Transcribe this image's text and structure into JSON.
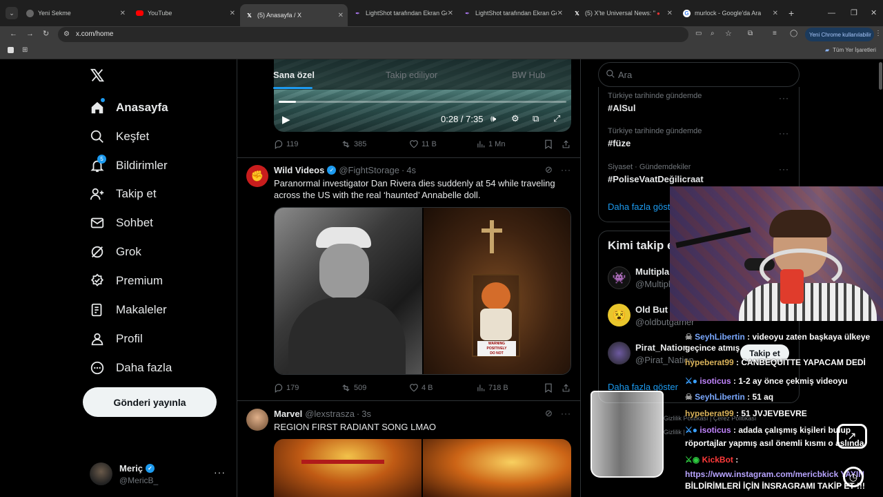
{
  "browser": {
    "tabs": [
      {
        "title": "Yeni Sekme",
        "icon": "chrome-icon"
      },
      {
        "title": "YouTube",
        "icon": "youtube-icon"
      },
      {
        "title": "(5) Anasayfa / X",
        "icon": "x-icon",
        "active": true
      },
      {
        "title": "LightShot tarafından Ekran Gör",
        "icon": "lightshot-icon"
      },
      {
        "title": "LightShot tarafından Ekran Gör",
        "icon": "lightshot-icon"
      },
      {
        "title": "(5) X'te Universal News: \"",
        "icon": "x-icon"
      },
      {
        "title": "murlock - Google'da Ara",
        "icon": "google-icon"
      }
    ],
    "url": "x.com/home",
    "chrome_update": "Yeni Chrome kullanılabilir",
    "bookmarks_label": "Tüm Yer İşaretleri"
  },
  "nav": {
    "items": [
      {
        "label": "Anasayfa",
        "icon": "home-icon"
      },
      {
        "label": "Keşfet",
        "icon": "search-icon"
      },
      {
        "label": "Bildirimler",
        "icon": "bell-icon",
        "badge": "5"
      },
      {
        "label": "Takip et",
        "icon": "person-add-icon"
      },
      {
        "label": "Sohbet",
        "icon": "mail-icon"
      },
      {
        "label": "Grok",
        "icon": "grok-icon"
      },
      {
        "label": "Premium",
        "icon": "premium-icon"
      },
      {
        "label": "Makaleler",
        "icon": "article-icon"
      },
      {
        "label": "Profil",
        "icon": "profile-icon"
      },
      {
        "label": "Daha fazla",
        "icon": "more-circle-icon"
      }
    ],
    "post_button": "Gönderi yayınla",
    "account": {
      "name": "Meriç",
      "handle": "@MericB_"
    }
  },
  "feed": {
    "tabs": [
      "Sana özel",
      "Takip ediliyor",
      "BW Hub"
    ],
    "video": {
      "time": "0:28 / 7:35",
      "progress": 0.06
    },
    "post1_stats": {
      "replies": "119",
      "reposts": "385",
      "likes": "11 B",
      "views": "1 Mn"
    },
    "post2": {
      "author": "Wild Videos",
      "handle": "@FightStorage",
      "time": "4s",
      "text": "Paranormal investigator Dan Rivera dies suddenly at 54 while traveling across the US with the real ‘haunted’ Annabelle doll.",
      "stats": {
        "replies": "179",
        "reposts": "509",
        "likes": "4 B",
        "views": "718 B"
      },
      "image_sign": [
        "WARNING",
        "POSITIVELY",
        "DO NOT"
      ]
    },
    "post3": {
      "author": "Marvel",
      "handle": "@lexstrasza",
      "time": "3s",
      "text": "REGION FIRST RADIANT SONG LMAO"
    }
  },
  "sidebar": {
    "search_placeholder": "Ara",
    "trends": [
      {
        "category": "Türkiye tarihinde gündemde",
        "tag": "#AlSul"
      },
      {
        "category": "Türkiye tarihinde gündemde",
        "tag": "#füze"
      },
      {
        "category": "Siyaset · Gündemdekiler",
        "tag": "#PoliseVaatDeğilicraat"
      }
    ],
    "show_more": "Daha fazla göster",
    "who_to_follow_title": "Kimi takip e",
    "follow": [
      {
        "name": "Multipla",
        "handle": "@Multipl"
      },
      {
        "name": "Old But C",
        "handle": "@oldbutgamer"
      },
      {
        "name": "Pirat_Nation",
        "handle": "@Pirat_Nation"
      }
    ],
    "follow_button": "Takip et",
    "show_more2": "Daha fazla göster",
    "footer": [
      "Gizlilik Politikası",
      "Çerez Politikası",
      "Gizlilik"
    ]
  },
  "stream_chat": [
    {
      "user": "SeyhLibertin",
      "msg": ": videoyu zaten başkaya ülkeye",
      "badges": "skull"
    },
    {
      "user": "",
      "msg": "geçince atmış"
    },
    {
      "user": "hypeberat99",
      "msg": ": CANBEQUITTE YAPACAM DEDİ",
      "badges": ""
    },
    {
      "user": "isoticus",
      "msg": ": 1-2 ay önce çekmiş videoyu",
      "badges": "mod"
    },
    {
      "user": "SeyhLibertin",
      "msg": ": 51 aq",
      "badges": "skull"
    },
    {
      "user": "hypeberat99",
      "msg": ": 51 JVJEVBEVRE",
      "badges": ""
    },
    {
      "user": "isoticus",
      "msg": ": adada çalışmış kişileri bulup",
      "badges": "mod"
    },
    {
      "user": "",
      "msg": "röportajlar yapmış asıl önemli kısmı o aslında"
    },
    {
      "user": "KickBot",
      "msg": ":",
      "badges": "bot"
    },
    {
      "user": "",
      "msg": "https://www.instagram.com/mericbkick YAYIN"
    },
    {
      "user": "",
      "msg": "BİLDİRİMLERİ İÇİN İNSRAGRAMI TAKİP ET !!!"
    }
  ],
  "colors": {
    "accent": "#1d9bf0",
    "bg": "#000000",
    "border": "#2f3336",
    "muted": "#71767b",
    "chat_user": "#d9b25a"
  }
}
